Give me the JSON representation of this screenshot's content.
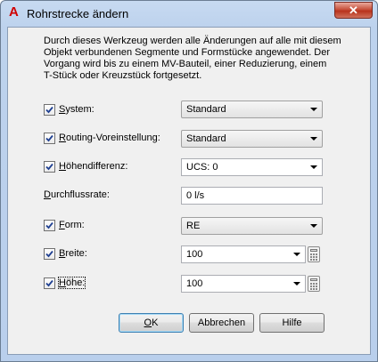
{
  "window": {
    "title": "Rohrstrecke ändern",
    "close_label": "✕"
  },
  "description": {
    "lines": [
      "Durch dieses Werkzeug werden alle Änderungen auf alle mit diesem",
      "Objekt verbundenen Segmente und Formstücke angewendet. Der",
      "Vorgang wird bis zu einem MV-Bauteil, einer Reduzierung, einem",
      "T-Stück oder Kreuzstück fortgesetzt."
    ]
  },
  "rows": {
    "system": {
      "label_accel": "S",
      "label_rest": "ystem:",
      "checked": true,
      "value": "Standard"
    },
    "routing": {
      "label_accel": "R",
      "label_rest": "outing-Voreinstellung:",
      "checked": true,
      "value": "Standard"
    },
    "hoehendifferenz": {
      "label_accel": "H",
      "label_rest": "öhendifferenz:",
      "checked": true,
      "value": "UCS: 0"
    },
    "durchflussrate": {
      "label_accel": "D",
      "label_rest": "urchflussrate:",
      "value": "0 l/s"
    },
    "form": {
      "label_accel": "F",
      "label_rest": "orm:",
      "checked": true,
      "value": "RE"
    },
    "breite": {
      "label_accel": "B",
      "label_rest": "reite:",
      "checked": true,
      "value": "100"
    },
    "hoehe": {
      "label_accel": "H",
      "label_rest": "öhe:",
      "checked": true,
      "value": "100"
    }
  },
  "buttons": {
    "ok_accel": "O",
    "ok_rest": "K",
    "cancel": "Abbrechen",
    "help": "Hilfe"
  },
  "colors": {
    "checkmark": "#1e3f91",
    "app_icon": "#d00000"
  },
  "icons": {
    "app": "autocad-a-icon",
    "calculator": "calculator-icon",
    "checkbox": "checkmark-icon"
  }
}
